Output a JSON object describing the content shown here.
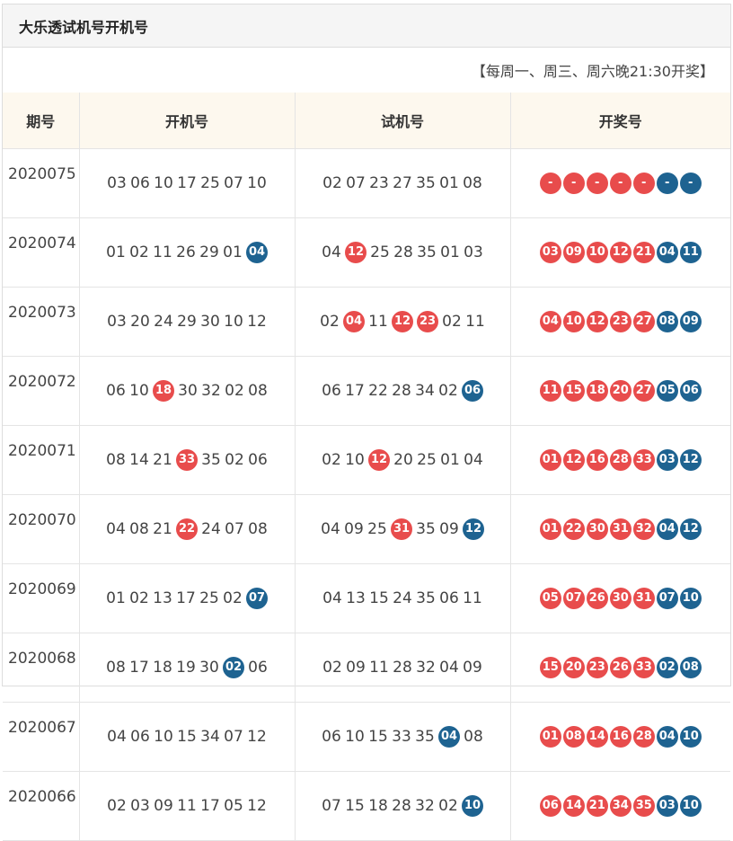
{
  "panel": {
    "title": "大乐透试机号开机号",
    "schedule": "【每周一、周三、周六晚21:30开奖】"
  },
  "columns": [
    "期号",
    "开机号",
    "试机号",
    "开奖号"
  ],
  "colors": {
    "red": "#e84c4c",
    "blue": "#1e6391",
    "header_bg": "#fdf8ee"
  },
  "rows": [
    {
      "issue": "2020075",
      "open": [
        {
          "t": "03",
          "h": ""
        },
        {
          "t": "06",
          "h": ""
        },
        {
          "t": "10",
          "h": ""
        },
        {
          "t": "17",
          "h": ""
        },
        {
          "t": "25",
          "h": ""
        },
        {
          "t": "07",
          "h": ""
        },
        {
          "t": "10",
          "h": ""
        }
      ],
      "test": [
        {
          "t": "02",
          "h": ""
        },
        {
          "t": "07",
          "h": ""
        },
        {
          "t": "23",
          "h": ""
        },
        {
          "t": "27",
          "h": ""
        },
        {
          "t": "35",
          "h": ""
        },
        {
          "t": "01",
          "h": ""
        },
        {
          "t": "08",
          "h": ""
        }
      ],
      "draw": [
        {
          "t": "-",
          "c": "red"
        },
        {
          "t": "-",
          "c": "red"
        },
        {
          "t": "-",
          "c": "red"
        },
        {
          "t": "-",
          "c": "red"
        },
        {
          "t": "-",
          "c": "red"
        },
        {
          "t": "-",
          "c": "blue"
        },
        {
          "t": "-",
          "c": "blue"
        }
      ]
    },
    {
      "issue": "2020074",
      "open": [
        {
          "t": "01",
          "h": ""
        },
        {
          "t": "02",
          "h": ""
        },
        {
          "t": "11",
          "h": ""
        },
        {
          "t": "26",
          "h": ""
        },
        {
          "t": "29",
          "h": ""
        },
        {
          "t": "01",
          "h": ""
        },
        {
          "t": "04",
          "h": "blue"
        }
      ],
      "test": [
        {
          "t": "04",
          "h": ""
        },
        {
          "t": "12",
          "h": "red"
        },
        {
          "t": "25",
          "h": ""
        },
        {
          "t": "28",
          "h": ""
        },
        {
          "t": "35",
          "h": ""
        },
        {
          "t": "01",
          "h": ""
        },
        {
          "t": "03",
          "h": ""
        }
      ],
      "draw": [
        {
          "t": "03",
          "c": "red"
        },
        {
          "t": "09",
          "c": "red"
        },
        {
          "t": "10",
          "c": "red"
        },
        {
          "t": "12",
          "c": "red"
        },
        {
          "t": "21",
          "c": "red"
        },
        {
          "t": "04",
          "c": "blue"
        },
        {
          "t": "11",
          "c": "blue"
        }
      ]
    },
    {
      "issue": "2020073",
      "open": [
        {
          "t": "03",
          "h": ""
        },
        {
          "t": "20",
          "h": ""
        },
        {
          "t": "24",
          "h": ""
        },
        {
          "t": "29",
          "h": ""
        },
        {
          "t": "30",
          "h": ""
        },
        {
          "t": "10",
          "h": ""
        },
        {
          "t": "12",
          "h": ""
        }
      ],
      "test": [
        {
          "t": "02",
          "h": ""
        },
        {
          "t": "04",
          "h": "red"
        },
        {
          "t": "11",
          "h": ""
        },
        {
          "t": "12",
          "h": "red"
        },
        {
          "t": "23",
          "h": "red"
        },
        {
          "t": "02",
          "h": ""
        },
        {
          "t": "11",
          "h": ""
        }
      ],
      "draw": [
        {
          "t": "04",
          "c": "red"
        },
        {
          "t": "10",
          "c": "red"
        },
        {
          "t": "12",
          "c": "red"
        },
        {
          "t": "23",
          "c": "red"
        },
        {
          "t": "27",
          "c": "red"
        },
        {
          "t": "08",
          "c": "blue"
        },
        {
          "t": "09",
          "c": "blue"
        }
      ]
    },
    {
      "issue": "2020072",
      "open": [
        {
          "t": "06",
          "h": ""
        },
        {
          "t": "10",
          "h": ""
        },
        {
          "t": "18",
          "h": "red"
        },
        {
          "t": "30",
          "h": ""
        },
        {
          "t": "32",
          "h": ""
        },
        {
          "t": "02",
          "h": ""
        },
        {
          "t": "08",
          "h": ""
        }
      ],
      "test": [
        {
          "t": "06",
          "h": ""
        },
        {
          "t": "17",
          "h": ""
        },
        {
          "t": "22",
          "h": ""
        },
        {
          "t": "28",
          "h": ""
        },
        {
          "t": "34",
          "h": ""
        },
        {
          "t": "02",
          "h": ""
        },
        {
          "t": "06",
          "h": "blue"
        }
      ],
      "draw": [
        {
          "t": "11",
          "c": "red"
        },
        {
          "t": "15",
          "c": "red"
        },
        {
          "t": "18",
          "c": "red"
        },
        {
          "t": "20",
          "c": "red"
        },
        {
          "t": "27",
          "c": "red"
        },
        {
          "t": "05",
          "c": "blue"
        },
        {
          "t": "06",
          "c": "blue"
        }
      ]
    },
    {
      "issue": "2020071",
      "open": [
        {
          "t": "08",
          "h": ""
        },
        {
          "t": "14",
          "h": ""
        },
        {
          "t": "21",
          "h": ""
        },
        {
          "t": "33",
          "h": "red"
        },
        {
          "t": "35",
          "h": ""
        },
        {
          "t": "02",
          "h": ""
        },
        {
          "t": "06",
          "h": ""
        }
      ],
      "test": [
        {
          "t": "02",
          "h": ""
        },
        {
          "t": "10",
          "h": ""
        },
        {
          "t": "12",
          "h": "red"
        },
        {
          "t": "20",
          "h": ""
        },
        {
          "t": "25",
          "h": ""
        },
        {
          "t": "01",
          "h": ""
        },
        {
          "t": "04",
          "h": ""
        }
      ],
      "draw": [
        {
          "t": "01",
          "c": "red"
        },
        {
          "t": "12",
          "c": "red"
        },
        {
          "t": "16",
          "c": "red"
        },
        {
          "t": "28",
          "c": "red"
        },
        {
          "t": "33",
          "c": "red"
        },
        {
          "t": "03",
          "c": "blue"
        },
        {
          "t": "12",
          "c": "blue"
        }
      ]
    },
    {
      "issue": "2020070",
      "open": [
        {
          "t": "04",
          "h": ""
        },
        {
          "t": "08",
          "h": ""
        },
        {
          "t": "21",
          "h": ""
        },
        {
          "t": "22",
          "h": "red"
        },
        {
          "t": "24",
          "h": ""
        },
        {
          "t": "07",
          "h": ""
        },
        {
          "t": "08",
          "h": ""
        }
      ],
      "test": [
        {
          "t": "04",
          "h": ""
        },
        {
          "t": "09",
          "h": ""
        },
        {
          "t": "25",
          "h": ""
        },
        {
          "t": "31",
          "h": "red"
        },
        {
          "t": "35",
          "h": ""
        },
        {
          "t": "09",
          "h": ""
        },
        {
          "t": "12",
          "h": "blue"
        }
      ],
      "draw": [
        {
          "t": "01",
          "c": "red"
        },
        {
          "t": "22",
          "c": "red"
        },
        {
          "t": "30",
          "c": "red"
        },
        {
          "t": "31",
          "c": "red"
        },
        {
          "t": "32",
          "c": "red"
        },
        {
          "t": "04",
          "c": "blue"
        },
        {
          "t": "12",
          "c": "blue"
        }
      ]
    },
    {
      "issue": "2020069",
      "open": [
        {
          "t": "01",
          "h": ""
        },
        {
          "t": "02",
          "h": ""
        },
        {
          "t": "13",
          "h": ""
        },
        {
          "t": "17",
          "h": ""
        },
        {
          "t": "25",
          "h": ""
        },
        {
          "t": "02",
          "h": ""
        },
        {
          "t": "07",
          "h": "blue"
        }
      ],
      "test": [
        {
          "t": "04",
          "h": ""
        },
        {
          "t": "13",
          "h": ""
        },
        {
          "t": "15",
          "h": ""
        },
        {
          "t": "24",
          "h": ""
        },
        {
          "t": "35",
          "h": ""
        },
        {
          "t": "06",
          "h": ""
        },
        {
          "t": "11",
          "h": ""
        }
      ],
      "draw": [
        {
          "t": "05",
          "c": "red"
        },
        {
          "t": "07",
          "c": "red"
        },
        {
          "t": "26",
          "c": "red"
        },
        {
          "t": "30",
          "c": "red"
        },
        {
          "t": "31",
          "c": "red"
        },
        {
          "t": "07",
          "c": "blue"
        },
        {
          "t": "10",
          "c": "blue"
        }
      ]
    },
    {
      "issue": "2020068",
      "open": [
        {
          "t": "08",
          "h": ""
        },
        {
          "t": "17",
          "h": ""
        },
        {
          "t": "18",
          "h": ""
        },
        {
          "t": "19",
          "h": ""
        },
        {
          "t": "30",
          "h": ""
        },
        {
          "t": "02",
          "h": "blue"
        },
        {
          "t": "06",
          "h": ""
        }
      ],
      "test": [
        {
          "t": "02",
          "h": ""
        },
        {
          "t": "09",
          "h": ""
        },
        {
          "t": "11",
          "h": ""
        },
        {
          "t": "28",
          "h": ""
        },
        {
          "t": "32",
          "h": ""
        },
        {
          "t": "04",
          "h": ""
        },
        {
          "t": "09",
          "h": ""
        }
      ],
      "draw": [
        {
          "t": "15",
          "c": "red"
        },
        {
          "t": "20",
          "c": "red"
        },
        {
          "t": "23",
          "c": "red"
        },
        {
          "t": "26",
          "c": "red"
        },
        {
          "t": "33",
          "c": "red"
        },
        {
          "t": "02",
          "c": "blue"
        },
        {
          "t": "08",
          "c": "blue"
        }
      ]
    },
    {
      "issue": "2020067",
      "open": [
        {
          "t": "04",
          "h": ""
        },
        {
          "t": "06",
          "h": ""
        },
        {
          "t": "10",
          "h": ""
        },
        {
          "t": "15",
          "h": ""
        },
        {
          "t": "34",
          "h": ""
        },
        {
          "t": "07",
          "h": ""
        },
        {
          "t": "12",
          "h": ""
        }
      ],
      "test": [
        {
          "t": "06",
          "h": ""
        },
        {
          "t": "10",
          "h": ""
        },
        {
          "t": "15",
          "h": ""
        },
        {
          "t": "33",
          "h": ""
        },
        {
          "t": "35",
          "h": ""
        },
        {
          "t": "04",
          "h": "blue"
        },
        {
          "t": "08",
          "h": ""
        }
      ],
      "draw": [
        {
          "t": "01",
          "c": "red"
        },
        {
          "t": "08",
          "c": "red"
        },
        {
          "t": "14",
          "c": "red"
        },
        {
          "t": "16",
          "c": "red"
        },
        {
          "t": "28",
          "c": "red"
        },
        {
          "t": "04",
          "c": "blue"
        },
        {
          "t": "10",
          "c": "blue"
        }
      ]
    },
    {
      "issue": "2020066",
      "open": [
        {
          "t": "02",
          "h": ""
        },
        {
          "t": "03",
          "h": ""
        },
        {
          "t": "09",
          "h": ""
        },
        {
          "t": "11",
          "h": ""
        },
        {
          "t": "17",
          "h": ""
        },
        {
          "t": "05",
          "h": ""
        },
        {
          "t": "12",
          "h": ""
        }
      ],
      "test": [
        {
          "t": "07",
          "h": ""
        },
        {
          "t": "15",
          "h": ""
        },
        {
          "t": "18",
          "h": ""
        },
        {
          "t": "28",
          "h": ""
        },
        {
          "t": "32",
          "h": ""
        },
        {
          "t": "02",
          "h": ""
        },
        {
          "t": "10",
          "h": "blue"
        }
      ],
      "draw": [
        {
          "t": "06",
          "c": "red"
        },
        {
          "t": "14",
          "c": "red"
        },
        {
          "t": "21",
          "c": "red"
        },
        {
          "t": "34",
          "c": "red"
        },
        {
          "t": "35",
          "c": "red"
        },
        {
          "t": "03",
          "c": "blue"
        },
        {
          "t": "10",
          "c": "blue"
        }
      ]
    }
  ]
}
